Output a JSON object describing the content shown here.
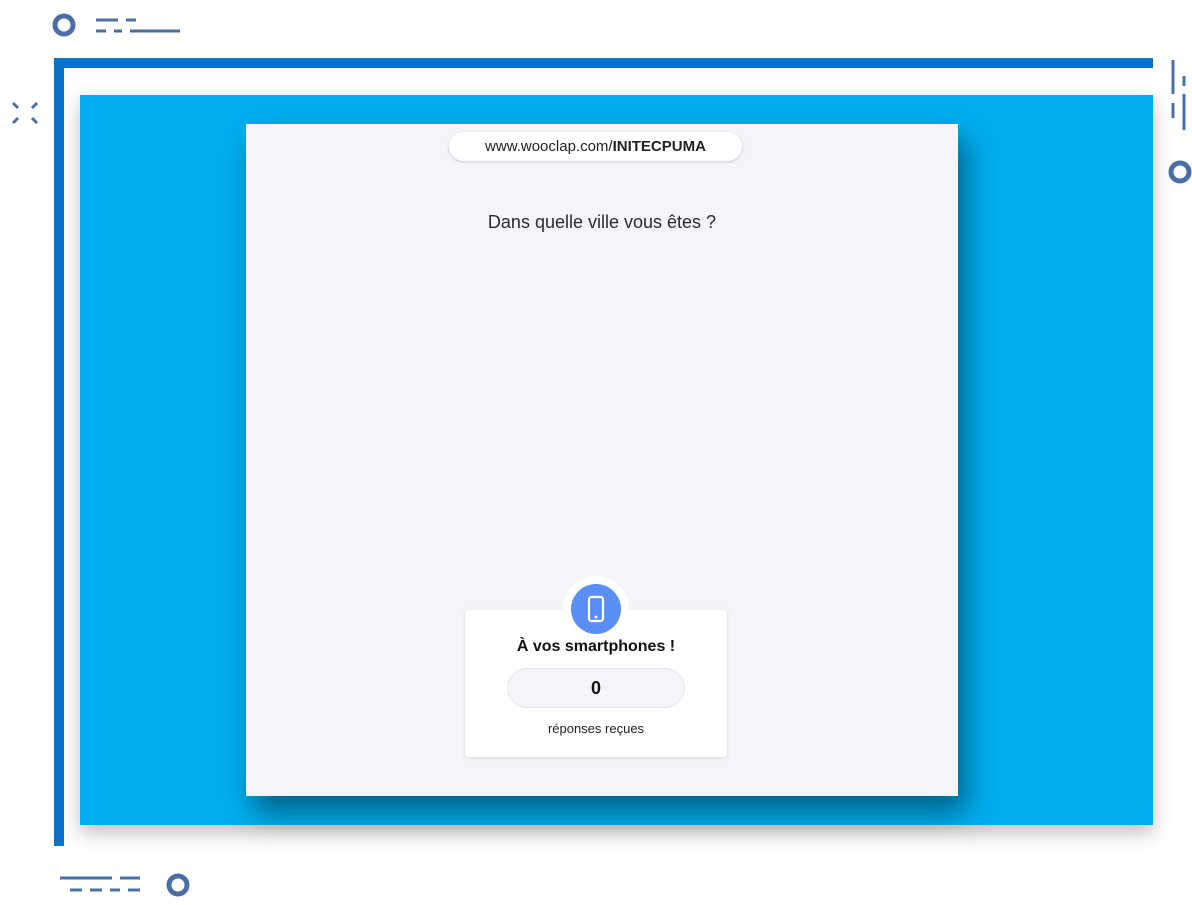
{
  "slide": {
    "url_prefix": "www.wooclap.com/",
    "url_code": "INITECPUMA",
    "question": "Dans quelle ville vous êtes ?"
  },
  "responses": {
    "title": "À vos smartphones !",
    "count": "0",
    "label": "réponses reçues"
  },
  "icons": {
    "phone": "smartphone-icon"
  },
  "colors": {
    "frame": "#0b72c9",
    "slide_background": "#00aeef",
    "card_background": "#f4f5f9",
    "phone_badge": "#5a8ef5",
    "decor": "#4a6fa5"
  }
}
